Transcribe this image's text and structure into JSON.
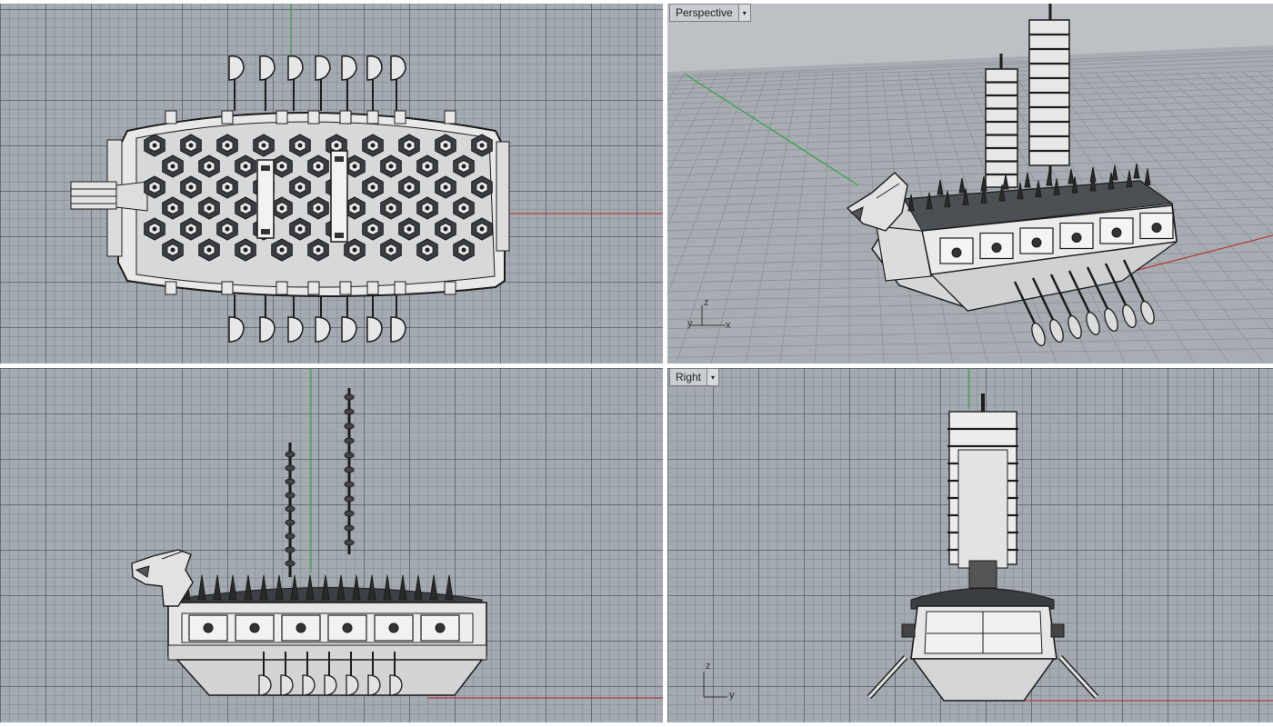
{
  "viewports": {
    "top": {
      "label": ""
    },
    "perspective": {
      "label": "Perspective",
      "axis": {
        "z": "z",
        "y": "y",
        "x": "x"
      }
    },
    "front": {
      "label": ""
    },
    "right": {
      "label": "Right",
      "axis": {
        "z": "z",
        "y": "y"
      }
    }
  },
  "icons": {
    "viewport_menu": "chevron-down-icon"
  },
  "colors": {
    "x_axis": "#b43c3c",
    "y_axis": "#3aa34a",
    "grid_bg": "#a4aab1",
    "ship_fill": "#e6e7e8",
    "ship_stroke": "#1c1c1c"
  }
}
